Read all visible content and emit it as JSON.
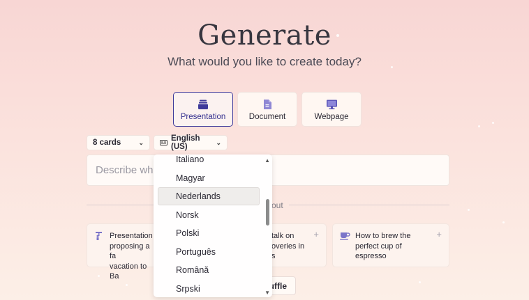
{
  "header": {
    "title": "Generate",
    "subtitle": "What would you like to create today?"
  },
  "types": [
    {
      "label": "Presentation",
      "icon": "stack-icon",
      "selected": true
    },
    {
      "label": "Document",
      "icon": "document-icon",
      "selected": false
    },
    {
      "label": "Webpage",
      "icon": "monitor-icon",
      "selected": false
    }
  ],
  "options": {
    "cards": "8 cards",
    "language": "English (US)"
  },
  "prompt": {
    "placeholder": "Describe what you'd like to make"
  },
  "examples": {
    "divider_label": "out",
    "cards": [
      {
        "text": [
          "Presentation",
          "proposing a fa",
          "vacation to Ba"
        ]
      },
      {
        "text": [
          "talk on",
          "overies in",
          "s"
        ]
      },
      {
        "text": [
          "How to brew the",
          "perfect cup of",
          "espresso"
        ]
      }
    ]
  },
  "shuffle_label": "uffle",
  "language_dropdown": {
    "items": [
      "Italiano",
      "Magyar",
      "Nederlands",
      "Norsk",
      "Polski",
      "Português",
      "Română",
      "Srpski"
    ],
    "highlighted": "Nederlands"
  },
  "colors": {
    "accent": "#3e3a9a",
    "icon_purple": "#7b74c9"
  }
}
